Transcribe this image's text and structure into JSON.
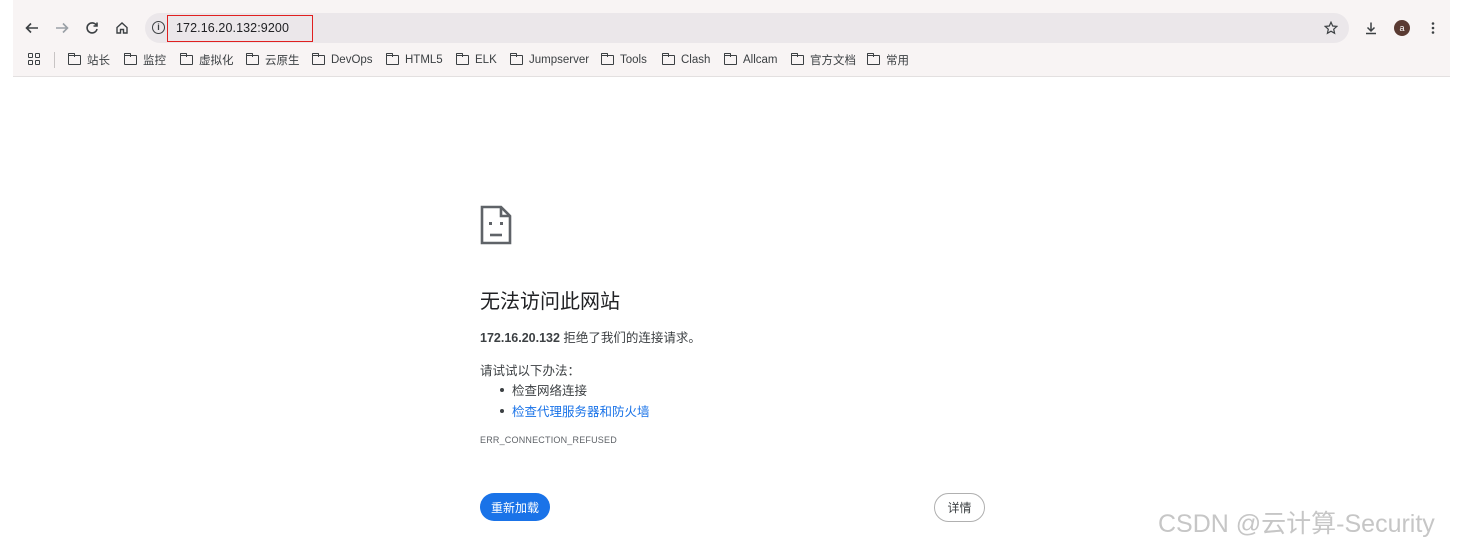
{
  "browser": {
    "address_bar": {
      "url": "172.16.20.132:9200",
      "info_icon": "info-icon"
    },
    "nav": [
      "back-icon",
      "forward-icon",
      "reload-icon",
      "home-icon"
    ],
    "toolbar_icons": [
      "star-icon",
      "download-icon",
      "menu-dots-icon"
    ],
    "avatar_letter": "a",
    "highlight_color": "#e02020"
  },
  "bookmarks": {
    "items": [
      {
        "label": "站长"
      },
      {
        "label": "监控"
      },
      {
        "label": "虚拟化"
      },
      {
        "label": "云原生"
      },
      {
        "label": "DevOps"
      },
      {
        "label": "HTML5"
      },
      {
        "label": "ELK"
      },
      {
        "label": "Jumpserver"
      },
      {
        "label": "Tools"
      },
      {
        "label": "Clash"
      },
      {
        "label": "Allcam"
      },
      {
        "label": "官方文档"
      },
      {
        "label": "常用"
      }
    ]
  },
  "error_page": {
    "icon": "sad-page-icon",
    "title": "无法访问此网站",
    "host": "172.16.20.132",
    "desc_suffix": " 拒绝了我们的连接请求。",
    "try_label": "请试试以下办法：",
    "suggestions": [
      "检查网络连接",
      "检查代理服务器和防火墙"
    ],
    "error_code": "ERR_CONNECTION_REFUSED",
    "reload_button": "重新加载",
    "details_button": "详情",
    "accent_color": "#1a73e8"
  },
  "watermark": "CSDN @云计算-Security"
}
